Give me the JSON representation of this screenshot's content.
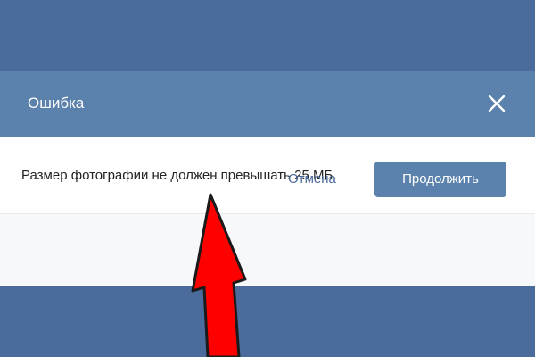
{
  "dialog": {
    "title": "Ошибка",
    "message": "Размер фотографии не должен превышать 25 МБ.",
    "cancel_label": "Отмена",
    "continue_label": "Продолжить",
    "close_icon": "close-icon"
  },
  "annotation": {
    "arrow_icon": "red-arrow-icon",
    "arrow_color": "#ff0000"
  },
  "colors": {
    "header": "#5b81ad",
    "backdrop": "#4b6b9c",
    "primary_button": "#5b81ad",
    "link": "#4b6b9c"
  }
}
